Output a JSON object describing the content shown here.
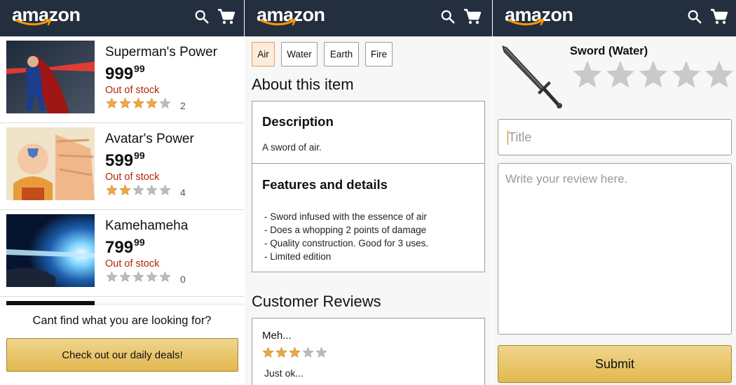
{
  "brand": "amazon",
  "colors": {
    "header": "#232f3e",
    "out_of_stock": "#b12704",
    "star_filled": "#f0a742",
    "star_empty": "#bbbbbb",
    "button": "#e8c463",
    "tab_selected": "#fdecd9"
  },
  "icons": {
    "search": "search-icon",
    "cart": "cart-icon"
  },
  "list_screen": {
    "items": [
      {
        "title": "Superman's Power",
        "price_whole": "999",
        "price_fraction": "99",
        "stock": "Out of stock",
        "rating": 4,
        "rating_count": "2",
        "image": "superman-image"
      },
      {
        "title": "Avatar's Power",
        "price_whole": "599",
        "price_fraction": "99",
        "stock": "Out of stock",
        "rating": 2,
        "rating_count": "4",
        "image": "avatar-image"
      },
      {
        "title": "Kamehameha",
        "price_whole": "799",
        "price_fraction": "99",
        "stock": "Out of stock",
        "rating": 0,
        "rating_count": "0",
        "image": "kamehameha-image"
      }
    ],
    "prompt_text": "Cant find what you are looking for?",
    "deals_button": "Check out our daily deals!"
  },
  "detail_screen": {
    "variants": [
      "Air",
      "Water",
      "Earth",
      "Fire"
    ],
    "selected_variant": "Air",
    "about_heading": "About this item",
    "description_heading": "Description",
    "description_text": "A sword of air.",
    "features_heading": "Features and details",
    "features": [
      "- Sword infused with the essence of air",
      "- Does a whopping 2 points of damage",
      "- Quality construction. Good for 3 uses.",
      "- Limited edition"
    ],
    "reviews_heading": "Customer Reviews",
    "review": {
      "title": "Meh...",
      "rating": 3,
      "body": "Just ok..."
    }
  },
  "review_screen": {
    "product_name": "Sword (Water)",
    "rating": 0,
    "title_placeholder": "Title",
    "review_placeholder": "Write your review here.",
    "submit_button": "Submit"
  }
}
